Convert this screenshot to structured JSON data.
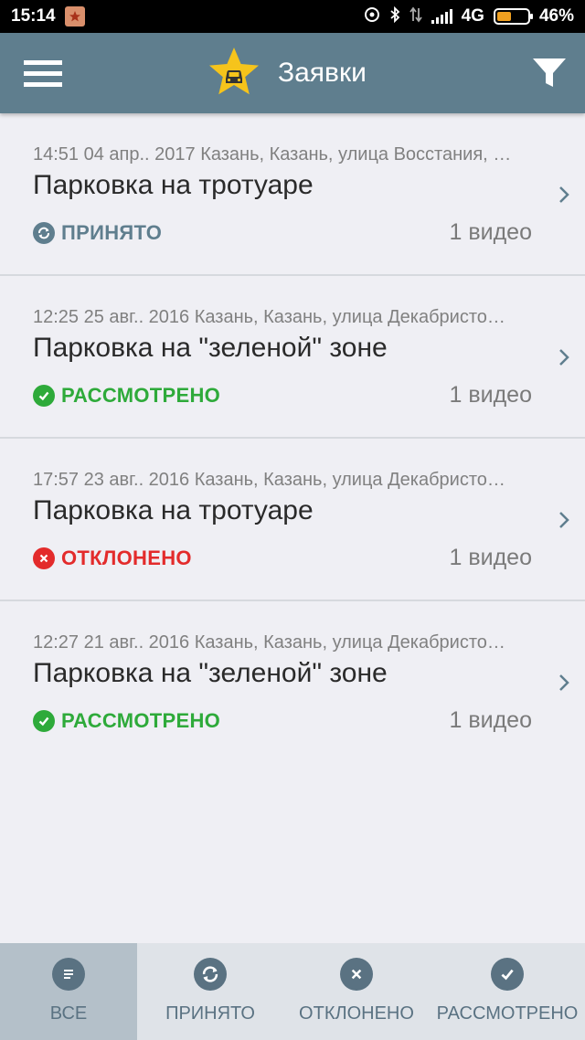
{
  "status_bar": {
    "time": "15:14",
    "network": "4G",
    "battery_percent": "46%",
    "battery_level": 0.46
  },
  "app_bar": {
    "title": "Заявки"
  },
  "colors": {
    "app_bar": "#5f7e8e",
    "accepted": "#5f7e8e",
    "reviewed": "#2eaa3a",
    "rejected": "#e32b2b",
    "logo_star": "#f6c41b"
  },
  "requests": [
    {
      "meta": "14:51 04 апр.. 2017 Казань, Казань, улица Восстания, …",
      "title": "Парковка на тротуаре",
      "status": "ПРИНЯТО",
      "status_kind": "accepted",
      "status_icon": "refresh-icon",
      "count": "1 видео"
    },
    {
      "meta": "12:25 25 авг.. 2016 Казань, Казань, улица Декабристо…",
      "title": "Парковка на \"зеленой\" зоне",
      "status": "РАССМОТРЕНО",
      "status_kind": "reviewed",
      "status_icon": "check-icon",
      "count": "1 видео"
    },
    {
      "meta": "17:57 23 авг.. 2016 Казань, Казань, улица Декабристо…",
      "title": "Парковка на тротуаре",
      "status": "ОТКЛОНЕНО",
      "status_kind": "rejected",
      "status_icon": "close-icon",
      "count": "1 видео"
    },
    {
      "meta": "12:27 21 авг.. 2016 Казань, Казань, улица Декабристо…",
      "title": "Парковка на \"зеленой\" зоне",
      "status": "РАССМОТРЕНО",
      "status_kind": "reviewed",
      "status_icon": "check-icon",
      "count": "1 видео"
    }
  ],
  "bottom_nav": {
    "tabs": [
      {
        "label": "ВСЕ",
        "icon": "list-icon",
        "active": true
      },
      {
        "label": "ПРИНЯТО",
        "icon": "refresh-icon",
        "active": false
      },
      {
        "label": "ОТКЛОНЕНО",
        "icon": "close-icon",
        "active": false
      },
      {
        "label": "РАССМОТРЕНО",
        "icon": "check-icon",
        "active": false
      }
    ]
  }
}
